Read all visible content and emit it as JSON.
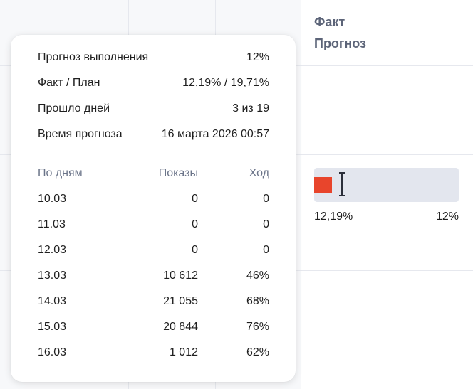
{
  "header": {
    "fact_label": "Факт",
    "forecast_label": "Прогноз"
  },
  "bar": {
    "fact_text": "12,19%",
    "forecast_text": "12%",
    "fact_value": 12.19,
    "forecast_percent": 12
  },
  "popover": {
    "summary": [
      {
        "label": "Прогноз выполнения",
        "value": "12%"
      },
      {
        "label": "Факт / План",
        "value": "12,19% / 19,71%"
      },
      {
        "label": "Прошло дней",
        "value": "3 из 19"
      },
      {
        "label": "Время прогноза",
        "value": "16 марта 2026 00:57"
      }
    ],
    "table": {
      "columns": [
        "По дням",
        "Показы",
        "Ход"
      ],
      "rows": [
        {
          "day": "10.03",
          "shows": "0",
          "progress": "0"
        },
        {
          "day": "11.03",
          "shows": "0",
          "progress": "0"
        },
        {
          "day": "12.03",
          "shows": "0",
          "progress": "0"
        },
        {
          "day": "13.03",
          "shows": "10 612",
          "progress": "46%"
        },
        {
          "day": "14.03",
          "shows": "21 055",
          "progress": "68%"
        },
        {
          "day": "15.03",
          "shows": "20 844",
          "progress": "76%"
        },
        {
          "day": "16.03",
          "shows": "1 012",
          "progress": "62%"
        }
      ]
    }
  },
  "colors": {
    "fact_fill": "#e8452c",
    "track": "#e3e6ee",
    "header_text": "#5c6478",
    "muted_text": "#6b7489"
  }
}
